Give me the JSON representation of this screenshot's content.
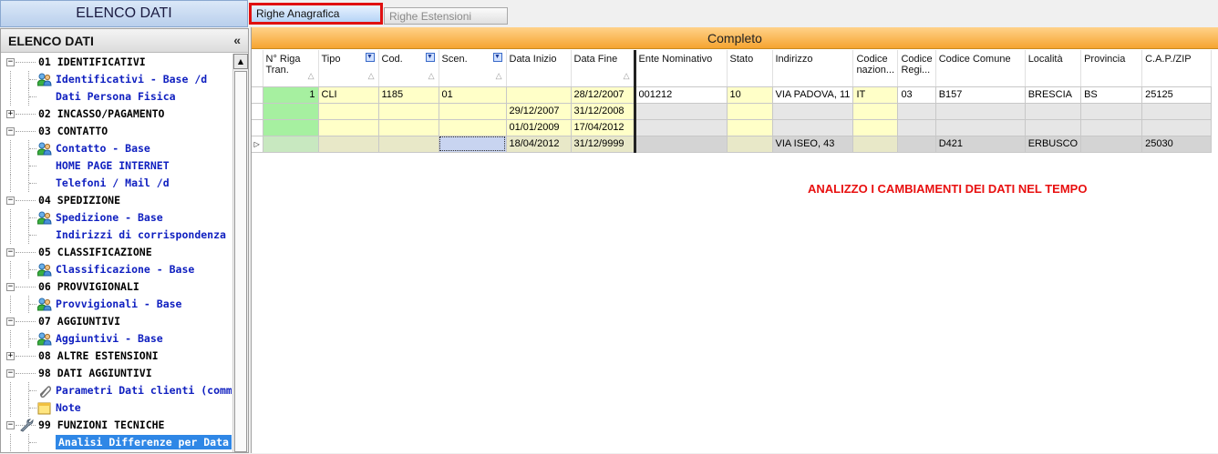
{
  "left_header": {
    "title": "ELENCO DATI"
  },
  "left_panel": {
    "title": "ELENCO DATI",
    "collapse_label": "«",
    "tree": [
      {
        "type": "group",
        "label": "01 IDENTIFICATIVI",
        "expander": "−"
      },
      {
        "type": "item",
        "label": "Identificativi - Base /d",
        "icon": "users-icon"
      },
      {
        "type": "item",
        "label": "Dati Persona Fisica",
        "icon": ""
      },
      {
        "type": "group",
        "label": "02 INCASSO/PAGAMENTO",
        "expander": "+"
      },
      {
        "type": "group",
        "label": "03 CONTATTO",
        "expander": "−"
      },
      {
        "type": "item",
        "label": "Contatto - Base",
        "icon": "users-icon"
      },
      {
        "type": "item",
        "label": "HOME PAGE INTERNET",
        "icon": ""
      },
      {
        "type": "item",
        "label": "Telefoni / Mail /d",
        "icon": ""
      },
      {
        "type": "group",
        "label": "04 SPEDIZIONE",
        "expander": "−"
      },
      {
        "type": "item",
        "label": "Spedizione - Base",
        "icon": "users-icon"
      },
      {
        "type": "item",
        "label": "Indirizzi di corrispondenza",
        "icon": ""
      },
      {
        "type": "group",
        "label": "05 CLASSIFICAZIONE",
        "expander": "−"
      },
      {
        "type": "item",
        "label": "Classificazione - Base",
        "icon": "users-icon"
      },
      {
        "type": "group",
        "label": "06 PROVVIGIONALI",
        "expander": "−"
      },
      {
        "type": "item",
        "label": "Provvigionali - Base",
        "icon": "users-icon"
      },
      {
        "type": "group",
        "label": "07 AGGIUNTIVI",
        "expander": "−"
      },
      {
        "type": "item",
        "label": "Aggiuntivi - Base",
        "icon": "users-icon"
      },
      {
        "type": "group",
        "label": "08 ALTRE ESTENSIONI",
        "expander": "+"
      },
      {
        "type": "group",
        "label": "98 DATI AGGIUNTIVI",
        "expander": "−"
      },
      {
        "type": "item",
        "label": "Parametri Dati clienti (comme",
        "icon": "paperclip-icon"
      },
      {
        "type": "item",
        "label": "Note",
        "icon": "note-icon"
      },
      {
        "type": "group",
        "label": "99 FUNZIONI TECNICHE",
        "expander": "−",
        "icon": "wrench-icon"
      },
      {
        "type": "item",
        "label": "Analisi Differenze per Data",
        "icon": "",
        "selected": true
      }
    ]
  },
  "tabs": {
    "active": "Righe Anagrafica",
    "inactive": "Righe Estensioni"
  },
  "grid": {
    "title": "Completo",
    "columns": [
      {
        "label": "N° Riga Tran.",
        "sort": true
      },
      {
        "label": "Tipo",
        "sort": true,
        "filter": true
      },
      {
        "label": "Cod.",
        "sort": true,
        "filter": true
      },
      {
        "label": "Scen.",
        "sort": true,
        "filter": true
      },
      {
        "label": "Data Inizio",
        "sort": false
      },
      {
        "label": "Data Fine",
        "sort": true
      },
      {
        "label": "Ente Nominativo",
        "sort": false
      },
      {
        "label": "Stato",
        "sort": false
      },
      {
        "label": "Indirizzo",
        "sort": false
      },
      {
        "label": "Codice nazion...",
        "sort": false
      },
      {
        "label": "Codice Regi...",
        "sort": false
      },
      {
        "label": "Codice Comune",
        "sort": false
      },
      {
        "label": "Località",
        "sort": false
      },
      {
        "label": "Provincia",
        "sort": false
      },
      {
        "label": "C.A.P./ZIP",
        "sort": false
      }
    ],
    "rows": [
      [
        "1",
        "CLI",
        "1185",
        "01",
        "",
        "28/12/2007",
        "001212",
        "10",
        "VIA PADOVA, 11",
        "IT",
        "03",
        "B157",
        "BRESCIA",
        "BS",
        "25125"
      ],
      [
        "",
        "",
        "",
        "",
        "29/12/2007",
        "31/12/2008",
        "",
        "",
        "",
        "",
        "",
        "",
        "",
        "",
        ""
      ],
      [
        "",
        "",
        "",
        "",
        "01/01/2009",
        "17/04/2012",
        "",
        "",
        "",
        "",
        "",
        "",
        "",
        "",
        ""
      ],
      [
        "",
        "",
        "",
        "",
        "18/04/2012",
        "31/12/9999",
        "",
        "",
        "VIA ISEO, 43",
        "",
        "",
        "D421",
        "ERBUSCO",
        "",
        "25030"
      ]
    ]
  },
  "annotation": "ANALIZZO I CAMBIAMENTI DEI DATI NEL TEMPO"
}
